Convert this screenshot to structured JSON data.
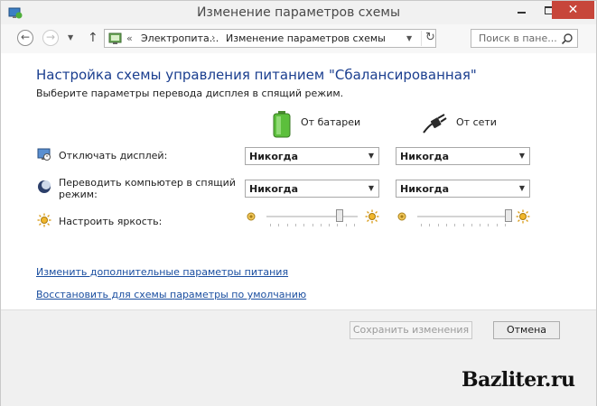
{
  "window": {
    "title": "Изменение параметров схемы",
    "close_glyph": "✕"
  },
  "nav": {
    "back_icon": "back-arrow-icon",
    "forward_icon": "forward-arrow-icon",
    "address": {
      "chevron": "«",
      "segment1": "Электропита...",
      "separator": "›",
      "segment2": "Изменение параметров схемы"
    },
    "search_placeholder": "Поиск в пане..."
  },
  "main": {
    "heading": "Настройка схемы управления питанием \"Сбалансированная\"",
    "subtext": "Выберите параметры перевода дисплея в спящий режим.",
    "columns": {
      "battery": "От батареи",
      "ac": "От сети"
    },
    "rows": {
      "display_off": {
        "label": "Отключать дисплей:",
        "battery": "Никогда",
        "ac": "Никогда"
      },
      "sleep": {
        "label": "Переводить компьютер в спящий режим:",
        "battery": "Никогда",
        "ac": "Никогда"
      },
      "brightness": {
        "label": "Настроить яркость:",
        "battery_level": 0.8,
        "ac_level": 1.0
      }
    },
    "links": {
      "advanced": "Изменить дополнительные параметры питания",
      "restore": "Восстановить для схемы параметры по умолчанию"
    }
  },
  "footer": {
    "save": "Сохранить изменения",
    "cancel": "Отмена"
  },
  "watermark": "Bazliter.ru",
  "colors": {
    "heading": "#1a3e8f",
    "link": "#1a4ea0",
    "close_button": "#c7463a"
  }
}
